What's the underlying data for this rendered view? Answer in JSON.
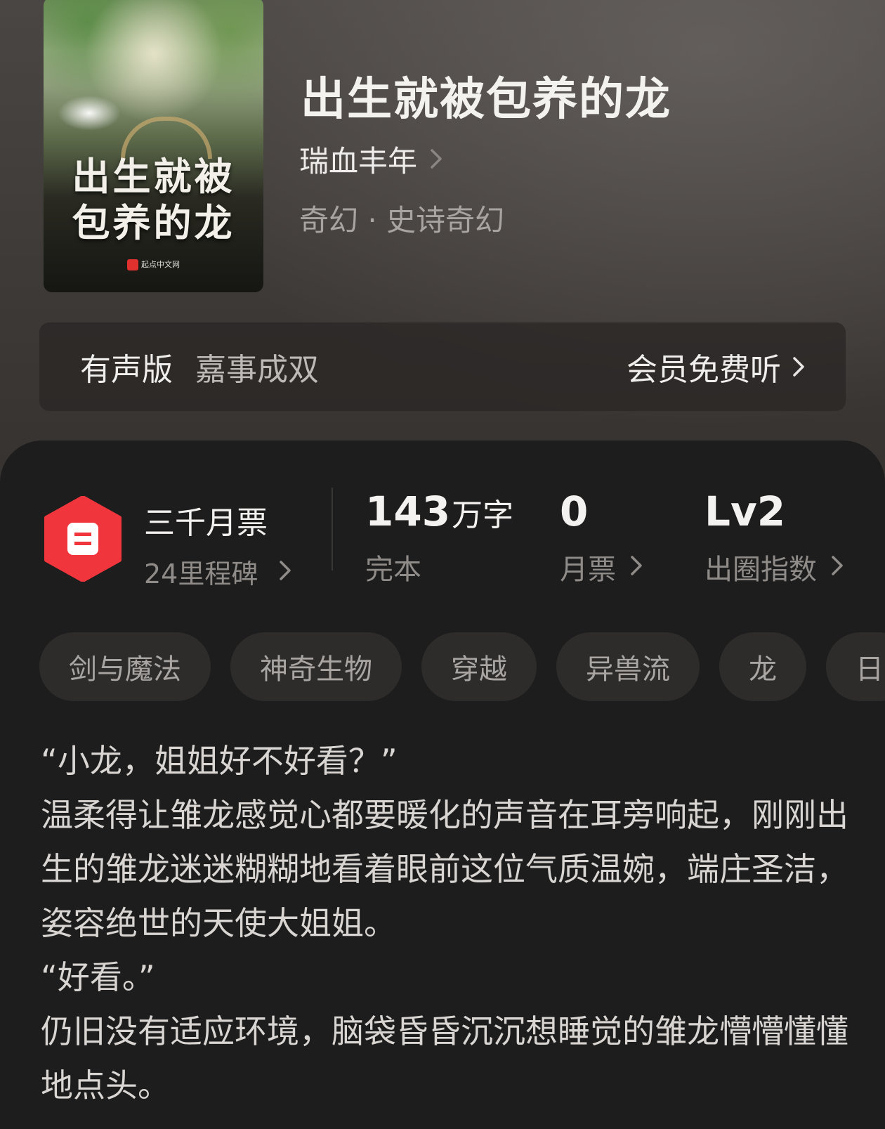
{
  "book": {
    "cover_title": "出生就被包养的龙",
    "cover_publisher": "起点中文网",
    "title": "出生就被包养的龙",
    "author": "瑞血丰年",
    "genre": "奇幻 · 史诗奇幻"
  },
  "audio": {
    "label": "有声版",
    "narrator": "嘉事成双",
    "action": "会员免费听"
  },
  "stats": {
    "monthly_title": "三千月票",
    "monthly_sub": "24里程碑",
    "words_num": "143",
    "words_unit": "万字",
    "words_caption": "完本",
    "tickets_num": "0",
    "tickets_caption": "月票",
    "level_num": "Lv2",
    "level_caption": "出圈指数"
  },
  "tags": [
    "剑与魔法",
    "神奇生物",
    "穿越",
    "异兽流",
    "龙",
    "日"
  ],
  "description": [
    "“小龙，姐姐好不好看？”",
    "温柔得让雏龙感觉心都要暖化的声音在耳旁响起，刚刚出生的雏龙迷迷糊糊地看着眼前这位气质温婉，端庄圣洁，姿容绝世的天使大姐姐。",
    "“好看。”",
    "仍旧没有适应环境，脑袋昏昏沉沉想睡觉的雏龙懵懵懂懂地点头。"
  ],
  "colors": {
    "badge_red": "#f0353c",
    "panel_bg": "#1e1d1d",
    "tag_bg": "#2d2c2b"
  }
}
